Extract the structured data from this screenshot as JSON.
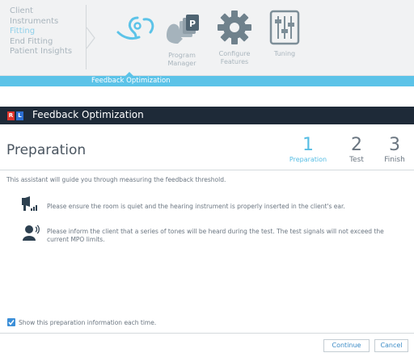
{
  "nav": {
    "items": [
      {
        "label": "Client",
        "active": false
      },
      {
        "label": "Instruments",
        "active": false
      },
      {
        "label": "Fitting",
        "active": true
      },
      {
        "label": "End Fitting",
        "active": false
      },
      {
        "label": "Patient Insights",
        "active": false
      }
    ]
  },
  "toolbar": {
    "tools": [
      {
        "name": "feedback-optimization",
        "label": "",
        "icon": "ear-feedback-icon",
        "selected": true
      },
      {
        "name": "program-manager",
        "label": "Program\nManager",
        "icon": "program-manager-icon"
      },
      {
        "name": "configure-features",
        "label": "Configure\nFeatures",
        "icon": "gear-icon"
      },
      {
        "name": "tuning",
        "label": "Tuning",
        "icon": "sliders-icon"
      }
    ]
  },
  "subbar": {
    "label": "Feedback Optimization"
  },
  "dialog": {
    "badge_r": "R",
    "badge_l": "L",
    "title": "Feedback Optimization",
    "heading": "Preparation",
    "steps": [
      {
        "num": "1",
        "label": "Preparation",
        "active": true
      },
      {
        "num": "2",
        "label": "Test",
        "active": false
      },
      {
        "num": "3",
        "label": "Finish",
        "active": false
      }
    ],
    "intro": "This assistant will guide you through measuring the feedback threshold.",
    "instructions": [
      {
        "icon": "quiet-room-icon",
        "text": "Please ensure the room is quiet and the hearing instrument is properly inserted in the client's ear."
      },
      {
        "icon": "inform-client-icon",
        "text": "Please inform the client that a series of tones will be heard during the test. The test signals will not exceed the current MPO limits."
      }
    ],
    "show_each_time": {
      "label": "Show this preparation information each time.",
      "checked": true
    },
    "buttons": {
      "continue": "Continue",
      "cancel": "Cancel"
    }
  },
  "colors": {
    "accent": "#56bde4",
    "titlebar": "#1e2a38",
    "badge_r": "#e0342c",
    "badge_l": "#2d6fd2",
    "checkbox": "#3c8fd8"
  }
}
